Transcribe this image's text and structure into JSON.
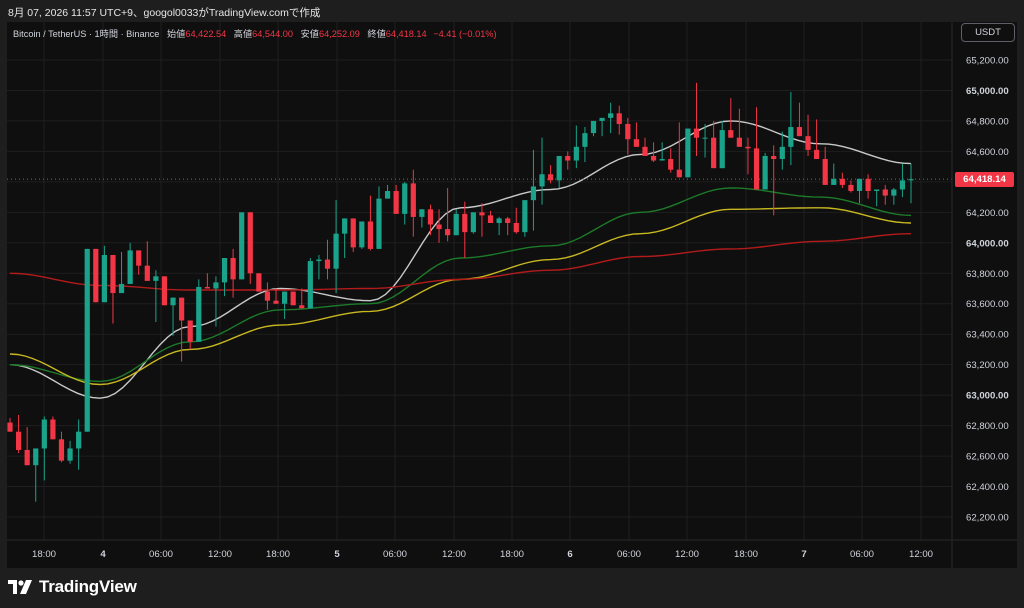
{
  "header": {
    "watermark_text": "8月 07, 2026 11:57 UTC+9、googol0033がTradingView.comで作成"
  },
  "legend": {
    "symbol": "Bitcoin / TetherUS · 1時間 · Binance",
    "open_label": "始値",
    "open": "64,422.54",
    "high_label": "高値",
    "high": "64,544.00",
    "low_label": "安値",
    "low": "64,252.09",
    "close_label": "終値",
    "close": "64,418.14",
    "change": "−4.41 (−0.01%)"
  },
  "currency_button": "USDT",
  "current_price_label": "64,418.14",
  "brand": {
    "name": "TradingView"
  },
  "colors": {
    "up": "#1aa38a",
    "down": "#f23645",
    "ma_white": "#c9c9c9",
    "ma_green": "#1c7a2a",
    "ma_yellow": "#c8b820",
    "ma_red": "#b31b1b",
    "grid": "#1f1f1f",
    "background": "#0f0f0f"
  },
  "chart_data": {
    "type": "candlestick",
    "title": "Bitcoin / TetherUS · 1時間 · Binance",
    "x_tick_labels": [
      "18:00",
      "4",
      "06:00",
      "12:00",
      "18:00",
      "5",
      "06:00",
      "12:00",
      "18:00",
      "6",
      "06:00",
      "12:00",
      "18:00",
      "7",
      "06:00",
      "12:00"
    ],
    "y_tick_labels": [
      "65,200.00",
      "65,000.00",
      "64,800.00",
      "64,600.00",
      "64,400.00",
      "64,200.00",
      "64,000.00",
      "63,800.00",
      "63,600.00",
      "63,400.00",
      "63,200.00",
      "63,000.00",
      "62,800.00",
      "62,600.00",
      "62,400.00",
      "62,200.00"
    ],
    "ylim": [
      62050,
      65300
    ],
    "current_price": 64418.14,
    "candles": [
      [
        62820,
        62850,
        62800,
        62760
      ],
      [
        62760,
        62870,
        62620,
        62640
      ],
      [
        62640,
        62790,
        62580,
        62540
      ],
      [
        62540,
        62640,
        62300,
        62650
      ],
      [
        62650,
        62860,
        62440,
        62840
      ],
      [
        62840,
        62860,
        62710,
        62710
      ],
      [
        62710,
        62760,
        62560,
        62570
      ],
      [
        62570,
        62700,
        62550,
        62650
      ],
      [
        62650,
        62840,
        62510,
        62760
      ],
      [
        62760,
        63920,
        62990,
        63960
      ],
      [
        63960,
        63950,
        63640,
        63610
      ],
      [
        63610,
        63980,
        63680,
        63920
      ],
      [
        63920,
        63710,
        63470,
        63670
      ],
      [
        63670,
        63940,
        63860,
        63730
      ],
      [
        63730,
        64000,
        63770,
        63950
      ],
      [
        63950,
        63850,
        63790,
        63850
      ],
      [
        63850,
        64010,
        63780,
        63750
      ],
      [
        63750,
        63820,
        63480,
        63780
      ],
      [
        63780,
        63650,
        63630,
        63590
      ],
      [
        63590,
        63640,
        63390,
        63640
      ],
      [
        63640,
        63550,
        63220,
        63490
      ],
      [
        63490,
        63330,
        63300,
        63350
      ],
      [
        63350,
        63760,
        63460,
        63710
      ],
      [
        63710,
        63800,
        63760,
        63700
      ],
      [
        63700,
        63780,
        63450,
        63740
      ],
      [
        63740,
        63750,
        63650,
        63900
      ],
      [
        63900,
        63960,
        63640,
        63760
      ],
      [
        63760,
        63990,
        63870,
        64200
      ],
      [
        64200,
        63830,
        63730,
        63800
      ],
      [
        63800,
        63640,
        63750,
        63680
      ],
      [
        63680,
        63740,
        63560,
        63620
      ],
      [
        63620,
        63700,
        63600,
        63600
      ],
      [
        63600,
        63640,
        63500,
        63680
      ],
      [
        63680,
        63650,
        63590,
        63590
      ],
      [
        63590,
        63700,
        63590,
        63570
      ],
      [
        63570,
        63900,
        63580,
        63880
      ],
      [
        63880,
        63920,
        63760,
        63890
      ],
      [
        63890,
        64020,
        63760,
        63830
      ],
      [
        63830,
        64280,
        63670,
        64060
      ],
      [
        64060,
        64130,
        63900,
        64160
      ],
      [
        64160,
        64100,
        63940,
        63970
      ],
      [
        63970,
        64140,
        63960,
        64140
      ],
      [
        64140,
        64310,
        63950,
        63960
      ],
      [
        63960,
        64370,
        63960,
        64290
      ],
      [
        64290,
        64380,
        64290,
        64340
      ],
      [
        64340,
        64380,
        64200,
        64190
      ],
      [
        64190,
        64400,
        64120,
        64390
      ],
      [
        64390,
        64480,
        64040,
        64170
      ],
      [
        64170,
        64210,
        64100,
        64220
      ],
      [
        64220,
        64250,
        64050,
        64120
      ],
      [
        64120,
        64220,
        64000,
        64090
      ],
      [
        64090,
        64360,
        64010,
        64050
      ],
      [
        64050,
        64220,
        64110,
        64190
      ],
      [
        64190,
        64270,
        63900,
        64070
      ],
      [
        64070,
        64170,
        64060,
        64200
      ],
      [
        64200,
        64260,
        64040,
        64180
      ],
      [
        64180,
        64210,
        64130,
        64130
      ],
      [
        64130,
        64170,
        64050,
        64160
      ],
      [
        64160,
        64170,
        64050,
        64130
      ],
      [
        64130,
        64230,
        64060,
        64070
      ],
      [
        64070,
        64200,
        64040,
        64280
      ],
      [
        64280,
        64610,
        64080,
        64370
      ],
      [
        64370,
        64690,
        64250,
        64450
      ],
      [
        64450,
        64510,
        64390,
        64410
      ],
      [
        64410,
        64520,
        64360,
        64570
      ],
      [
        64570,
        64600,
        64480,
        64540
      ],
      [
        64540,
        64770,
        64490,
        64630
      ],
      [
        64630,
        64760,
        64530,
        64720
      ],
      [
        64720,
        64790,
        64700,
        64800
      ],
      [
        64800,
        64810,
        64700,
        64820
      ],
      [
        64820,
        64920,
        64720,
        64850
      ],
      [
        64850,
        64900,
        64710,
        64780
      ],
      [
        64780,
        64820,
        64580,
        64680
      ],
      [
        64680,
        64790,
        64640,
        64630
      ],
      [
        64630,
        64690,
        64570,
        64570
      ],
      [
        64570,
        64660,
        64530,
        64540
      ],
      [
        64540,
        64660,
        64550,
        64550
      ],
      [
        64550,
        64620,
        64460,
        64480
      ],
      [
        64480,
        64790,
        64470,
        64430
      ],
      [
        64430,
        64570,
        64440,
        64750
      ],
      [
        64750,
        65050,
        64570,
        64690
      ],
      [
        64690,
        64780,
        64560,
        64690
      ],
      [
        64690,
        64800,
        64640,
        64490
      ],
      [
        64490,
        64800,
        64680,
        64740
      ],
      [
        64740,
        64950,
        64770,
        64690
      ],
      [
        64690,
        64880,
        64660,
        64630
      ],
      [
        64630,
        64690,
        64450,
        64620
      ],
      [
        64620,
        64890,
        64360,
        64350
      ],
      [
        64350,
        64590,
        64370,
        64570
      ],
      [
        64570,
        64640,
        64180,
        64550
      ],
      [
        64550,
        64730,
        64480,
        64630
      ],
      [
        64630,
        64990,
        64510,
        64760
      ],
      [
        64760,
        64920,
        64790,
        64700
      ],
      [
        64700,
        64840,
        64570,
        64610
      ],
      [
        64610,
        64810,
        64580,
        64550
      ],
      [
        64550,
        64630,
        64390,
        64380
      ],
      [
        64380,
        64520,
        64380,
        64420
      ],
      [
        64420,
        64460,
        64360,
        64380
      ],
      [
        64380,
        64410,
        64330,
        64340
      ],
      [
        64340,
        64420,
        64260,
        64420
      ],
      [
        64420,
        64450,
        64290,
        64340
      ],
      [
        64340,
        64310,
        64240,
        64350
      ],
      [
        64350,
        64380,
        64250,
        64310
      ],
      [
        64310,
        64360,
        64250,
        64350
      ],
      [
        64350,
        64520,
        64300,
        64410
      ],
      [
        64410,
        64520,
        64260,
        64418
      ]
    ],
    "series": [
      {
        "color": "#c9c9c9",
        "values": [
          63200,
          62980,
          63450,
          63700,
          63620,
          64230,
          64350,
          64580,
          64800,
          64650,
          64520
        ]
      },
      {
        "color": "#1c7a2a",
        "values": [
          63200,
          63090,
          63350,
          63560,
          63600,
          63900,
          63980,
          64200,
          64360,
          64300,
          64180
        ]
      },
      {
        "color": "#c8b820",
        "values": [
          63270,
          63070,
          63300,
          63460,
          63550,
          63760,
          63890,
          64060,
          64220,
          64230,
          64130
        ]
      },
      {
        "color": "#b31b1b",
        "values": [
          63800,
          63720,
          63690,
          63690,
          63700,
          63760,
          63820,
          63910,
          63960,
          64010,
          64060
        ]
      }
    ]
  }
}
